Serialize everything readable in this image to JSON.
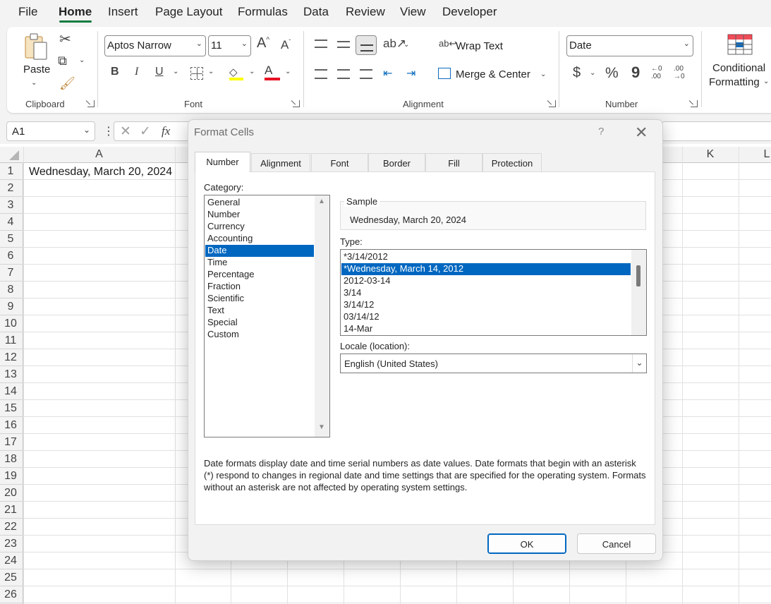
{
  "menu": {
    "tabs": [
      "File",
      "Home",
      "Insert",
      "Page Layout",
      "Formulas",
      "Data",
      "Review",
      "View",
      "Developer"
    ],
    "active": "Home"
  },
  "ribbon": {
    "clipboard": {
      "paste": "Paste",
      "label": "Clipboard"
    },
    "font": {
      "family": "Aptos Narrow",
      "size": "11",
      "bold": "B",
      "italic": "I",
      "underline": "U",
      "grow": "A",
      "shrink": "A",
      "font_color": "A",
      "label": "Font"
    },
    "alignment": {
      "wrap_text": "Wrap Text",
      "merge_center": "Merge & Center",
      "label": "Alignment"
    },
    "number": {
      "format": "Date",
      "currency": "$",
      "percent": "%",
      "comma": "9",
      "inc_decimal_top": "←0",
      "inc_decimal_bot": ".00",
      "dec_decimal_top": ".00",
      "dec_decimal_bot": "→0",
      "label": "Number"
    },
    "styles": {
      "conditional_1": "Conditional",
      "conditional_2": "Formatting"
    }
  },
  "formula_bar": {
    "name_box": "A1",
    "fx": "fx"
  },
  "sheet": {
    "columns": [
      "A",
      "K",
      "L"
    ],
    "rows": [
      "1",
      "2",
      "3",
      "4",
      "5",
      "6",
      "7",
      "8",
      "9",
      "10",
      "11",
      "12",
      "13",
      "14",
      "15",
      "16",
      "17",
      "18",
      "19",
      "20",
      "21",
      "22",
      "23",
      "24",
      "25",
      "26"
    ],
    "A1": "Wednesday, March 20, 2024"
  },
  "dialog": {
    "title": "Format Cells",
    "help": "?",
    "tabs": [
      "Number",
      "Alignment",
      "Font",
      "Border",
      "Fill",
      "Protection"
    ],
    "active_tab": "Number",
    "category_label": "Category:",
    "categories": [
      "General",
      "Number",
      "Currency",
      "Accounting",
      "Date",
      "Time",
      "Percentage",
      "Fraction",
      "Scientific",
      "Text",
      "Special",
      "Custom"
    ],
    "selected_category": "Date",
    "sample_label": "Sample",
    "sample_value": "Wednesday, March 20, 2024",
    "type_label": "Type:",
    "types": [
      "*3/14/2012",
      "*Wednesday, March 14, 2012",
      "2012-03-14",
      "3/14",
      "3/14/12",
      "03/14/12",
      "14-Mar"
    ],
    "selected_type": "*Wednesday, March 14, 2012",
    "locale_label": "Locale (location):",
    "locale_value": "English (United States)",
    "description": "Date formats display date and time serial numbers as date values.  Date formats that begin with an asterisk (*) respond to changes in regional date and time settings that are specified for the operating system. Formats without an asterisk are not affected by operating system settings.",
    "ok": "OK",
    "cancel": "Cancel"
  }
}
